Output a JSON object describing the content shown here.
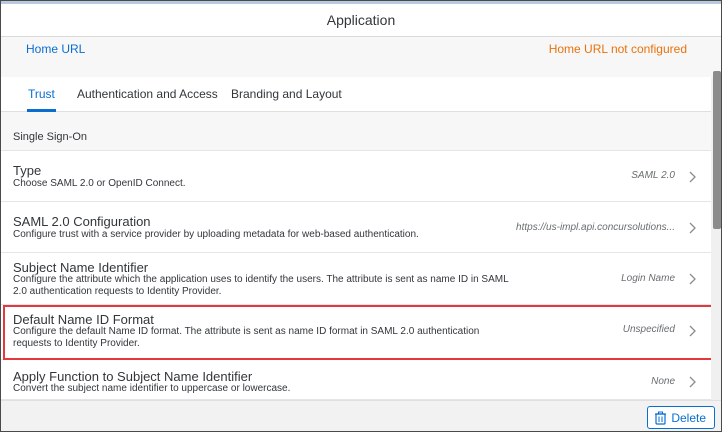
{
  "window": {
    "title": "Application"
  },
  "home": {
    "label": "Home URL",
    "value": "Home URL not configured"
  },
  "tabs": [
    {
      "label": "Trust",
      "active": true
    },
    {
      "label": "Authentication and Access",
      "active": false
    },
    {
      "label": "Branding and Layout",
      "active": false
    }
  ],
  "section": {
    "title": "Single Sign-On"
  },
  "rows": [
    {
      "title": "Type",
      "description": "Choose SAML 2.0 or OpenID Connect.",
      "value": "SAML 2.0"
    },
    {
      "title": "SAML 2.0 Configuration",
      "description": "Configure trust with a service provider by uploading metadata for web-based authentication.",
      "value": "https://us-impl.api.concursolutions..."
    },
    {
      "title": "Subject Name Identifier",
      "description": "Configure the attribute which the application uses to identify the users. The attribute is sent as name ID in SAML 2.0 authentication requests to Identity Provider.",
      "value": "Login Name"
    },
    {
      "title": "Default Name ID Format",
      "description": "Configure the default Name ID format. The attribute is sent as name ID format in SAML 2.0 authentication requests to Identity Provider.",
      "value": "Unspecified"
    },
    {
      "title": "Apply Function to Subject Name Identifier",
      "description": "Convert the subject name identifier to uppercase or lowercase.",
      "value": "None"
    }
  ],
  "footer": {
    "delete_label": "Delete"
  },
  "colors": {
    "accent": "#0a6ed1",
    "warning": "#e9730c",
    "highlight": "#e2383e"
  },
  "icons": {
    "chevron": "chevron-right-icon",
    "delete": "trash-icon"
  }
}
